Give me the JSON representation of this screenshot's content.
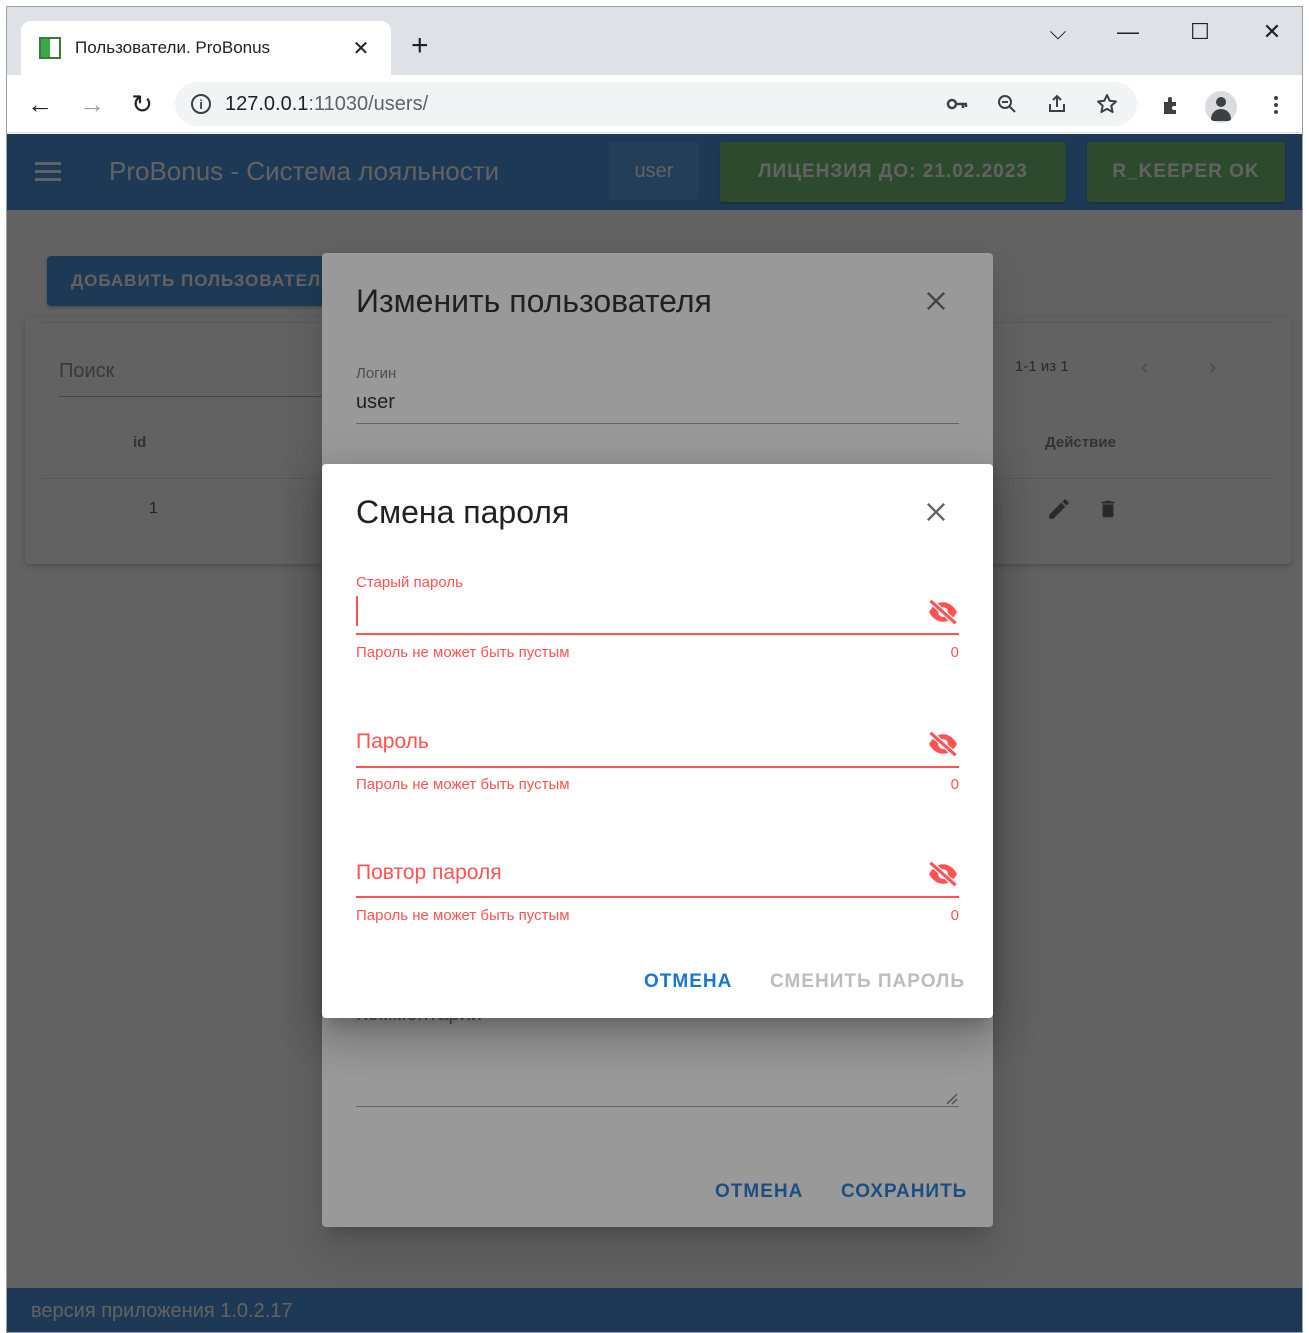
{
  "browser": {
    "tab_title": "Пользователи. ProBonus",
    "tab_close": "✕",
    "new_tab": "+",
    "url_host": "127.0.0.1",
    "url_rest": ":11030/users/",
    "window_controls": {
      "dropdown": "⌵",
      "minimize": "—",
      "maximize": "☐",
      "close": "✕"
    },
    "nav": {
      "back": "←",
      "forward": "→",
      "reload": "↻"
    },
    "icons": [
      "key-icon",
      "zoom-icon",
      "share-icon",
      "star-icon",
      "extensions-icon",
      "profile-icon",
      "menu-icon"
    ]
  },
  "appbar": {
    "title": "ProBonus - Система лояльности",
    "user": "user",
    "license": "ЛИЦЕНЗИЯ ДО: 21.02.2023",
    "rkeeper": "R_KEEPER OK"
  },
  "page": {
    "add_user_button": "ДОБАВИТЬ ПОЛЬЗОВАТЕЛЯ",
    "search_placeholder": "Поиск",
    "pagination": "1-1 из 1",
    "table": {
      "headers": {
        "id": "id",
        "action": "Действие"
      },
      "rows": [
        {
          "id": "1"
        }
      ]
    },
    "footer": "версия приложения 1.0.2.17"
  },
  "edit_dialog": {
    "title": "Изменить пользователя",
    "login_label": "Логин",
    "login_value": "user",
    "notes_label": "Комментарий",
    "cancel": "ОТМЕНА",
    "save": "СОХРАНИТЬ"
  },
  "password_dialog": {
    "title": "Смена пароля",
    "old_password_label": "Старый пароль",
    "password_label": "Пароль",
    "repeat_label": "Повтор пароля",
    "error": "Пароль не может быть пустым",
    "counter": "0",
    "cancel": "ОТМЕНА",
    "submit": "СМЕНИТЬ ПАРОЛЬ"
  },
  "colors": {
    "primary": "#1976d2",
    "success": "#4caf50",
    "error": "#ff5252"
  }
}
